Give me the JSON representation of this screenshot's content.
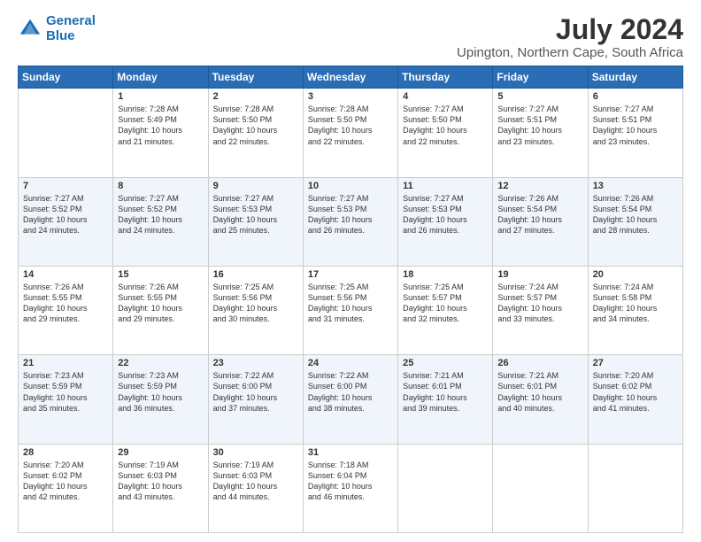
{
  "logo": {
    "line1": "General",
    "line2": "Blue"
  },
  "title": "July 2024",
  "subtitle": "Upington, Northern Cape, South Africa",
  "weekdays": [
    "Sunday",
    "Monday",
    "Tuesday",
    "Wednesday",
    "Thursday",
    "Friday",
    "Saturday"
  ],
  "weeks": [
    [
      {
        "day": "",
        "info": ""
      },
      {
        "day": "1",
        "info": "Sunrise: 7:28 AM\nSunset: 5:49 PM\nDaylight: 10 hours\nand 21 minutes."
      },
      {
        "day": "2",
        "info": "Sunrise: 7:28 AM\nSunset: 5:50 PM\nDaylight: 10 hours\nand 22 minutes."
      },
      {
        "day": "3",
        "info": "Sunrise: 7:28 AM\nSunset: 5:50 PM\nDaylight: 10 hours\nand 22 minutes."
      },
      {
        "day": "4",
        "info": "Sunrise: 7:27 AM\nSunset: 5:50 PM\nDaylight: 10 hours\nand 22 minutes."
      },
      {
        "day": "5",
        "info": "Sunrise: 7:27 AM\nSunset: 5:51 PM\nDaylight: 10 hours\nand 23 minutes."
      },
      {
        "day": "6",
        "info": "Sunrise: 7:27 AM\nSunset: 5:51 PM\nDaylight: 10 hours\nand 23 minutes."
      }
    ],
    [
      {
        "day": "7",
        "info": "Sunrise: 7:27 AM\nSunset: 5:52 PM\nDaylight: 10 hours\nand 24 minutes."
      },
      {
        "day": "8",
        "info": "Sunrise: 7:27 AM\nSunset: 5:52 PM\nDaylight: 10 hours\nand 24 minutes."
      },
      {
        "day": "9",
        "info": "Sunrise: 7:27 AM\nSunset: 5:53 PM\nDaylight: 10 hours\nand 25 minutes."
      },
      {
        "day": "10",
        "info": "Sunrise: 7:27 AM\nSunset: 5:53 PM\nDaylight: 10 hours\nand 26 minutes."
      },
      {
        "day": "11",
        "info": "Sunrise: 7:27 AM\nSunset: 5:53 PM\nDaylight: 10 hours\nand 26 minutes."
      },
      {
        "day": "12",
        "info": "Sunrise: 7:26 AM\nSunset: 5:54 PM\nDaylight: 10 hours\nand 27 minutes."
      },
      {
        "day": "13",
        "info": "Sunrise: 7:26 AM\nSunset: 5:54 PM\nDaylight: 10 hours\nand 28 minutes."
      }
    ],
    [
      {
        "day": "14",
        "info": "Sunrise: 7:26 AM\nSunset: 5:55 PM\nDaylight: 10 hours\nand 29 minutes."
      },
      {
        "day": "15",
        "info": "Sunrise: 7:26 AM\nSunset: 5:55 PM\nDaylight: 10 hours\nand 29 minutes."
      },
      {
        "day": "16",
        "info": "Sunrise: 7:25 AM\nSunset: 5:56 PM\nDaylight: 10 hours\nand 30 minutes."
      },
      {
        "day": "17",
        "info": "Sunrise: 7:25 AM\nSunset: 5:56 PM\nDaylight: 10 hours\nand 31 minutes."
      },
      {
        "day": "18",
        "info": "Sunrise: 7:25 AM\nSunset: 5:57 PM\nDaylight: 10 hours\nand 32 minutes."
      },
      {
        "day": "19",
        "info": "Sunrise: 7:24 AM\nSunset: 5:57 PM\nDaylight: 10 hours\nand 33 minutes."
      },
      {
        "day": "20",
        "info": "Sunrise: 7:24 AM\nSunset: 5:58 PM\nDaylight: 10 hours\nand 34 minutes."
      }
    ],
    [
      {
        "day": "21",
        "info": "Sunrise: 7:23 AM\nSunset: 5:59 PM\nDaylight: 10 hours\nand 35 minutes."
      },
      {
        "day": "22",
        "info": "Sunrise: 7:23 AM\nSunset: 5:59 PM\nDaylight: 10 hours\nand 36 minutes."
      },
      {
        "day": "23",
        "info": "Sunrise: 7:22 AM\nSunset: 6:00 PM\nDaylight: 10 hours\nand 37 minutes."
      },
      {
        "day": "24",
        "info": "Sunrise: 7:22 AM\nSunset: 6:00 PM\nDaylight: 10 hours\nand 38 minutes."
      },
      {
        "day": "25",
        "info": "Sunrise: 7:21 AM\nSunset: 6:01 PM\nDaylight: 10 hours\nand 39 minutes."
      },
      {
        "day": "26",
        "info": "Sunrise: 7:21 AM\nSunset: 6:01 PM\nDaylight: 10 hours\nand 40 minutes."
      },
      {
        "day": "27",
        "info": "Sunrise: 7:20 AM\nSunset: 6:02 PM\nDaylight: 10 hours\nand 41 minutes."
      }
    ],
    [
      {
        "day": "28",
        "info": "Sunrise: 7:20 AM\nSunset: 6:02 PM\nDaylight: 10 hours\nand 42 minutes."
      },
      {
        "day": "29",
        "info": "Sunrise: 7:19 AM\nSunset: 6:03 PM\nDaylight: 10 hours\nand 43 minutes."
      },
      {
        "day": "30",
        "info": "Sunrise: 7:19 AM\nSunset: 6:03 PM\nDaylight: 10 hours\nand 44 minutes."
      },
      {
        "day": "31",
        "info": "Sunrise: 7:18 AM\nSunset: 6:04 PM\nDaylight: 10 hours\nand 46 minutes."
      },
      {
        "day": "",
        "info": ""
      },
      {
        "day": "",
        "info": ""
      },
      {
        "day": "",
        "info": ""
      }
    ]
  ]
}
